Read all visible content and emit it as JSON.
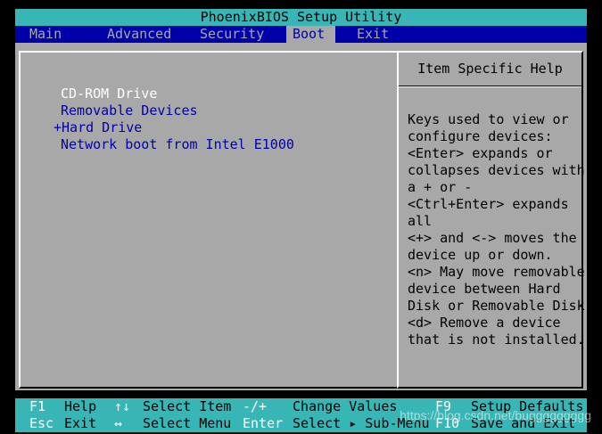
{
  "title": "PhoenixBIOS Setup Utility",
  "menu": {
    "tabs": [
      {
        "label": "Main"
      },
      {
        "label": "Advanced"
      },
      {
        "label": "Security"
      },
      {
        "label": "Boot"
      },
      {
        "label": "Exit"
      }
    ],
    "active": "Boot"
  },
  "boot": {
    "items": [
      {
        "label": "CD-ROM Drive",
        "selected": true
      },
      {
        "label": "Removable Devices"
      },
      {
        "label": "+Hard Drive"
      },
      {
        "label": "Network boot from Intel E1000"
      }
    ]
  },
  "help": {
    "title": "Item Specific Help",
    "lines": [
      "Keys used to view or",
      "configure devices:",
      "<Enter> expands or",
      "collapses devices with",
      "a + or -",
      "<Ctrl+Enter> expands",
      "all",
      "<+> and <-> moves the",
      "device up or down.",
      "<n> May move removable",
      "device between Hard",
      "Disk or Removable Disk",
      "<d> Remove a device",
      "that is not installed."
    ]
  },
  "footer": {
    "row1": [
      {
        "key": "F1",
        "desc": "Help"
      },
      {
        "key": "↑↓",
        "desc": "Select Item"
      },
      {
        "key": "-/+",
        "desc": "Change Values"
      },
      {
        "key": "F9",
        "desc": "Setup Defaults"
      }
    ],
    "row2": [
      {
        "key": "Esc",
        "desc": "Exit"
      },
      {
        "key": "↔",
        "desc": "Select Menu"
      },
      {
        "key": "Enter",
        "desc": "Select ▸ Sub-Menu"
      },
      {
        "key": "F10",
        "desc": "Save and Exit"
      }
    ]
  },
  "watermark": "https://blog.csdn.net/buggggggggg",
  "colors": {
    "background": "#000000",
    "title_bar": "#38b5b5",
    "menu_bar": "#0000a8",
    "panel": "#a8a8a8",
    "selected_text": "#ffffff",
    "item_text": "#0000a8"
  }
}
